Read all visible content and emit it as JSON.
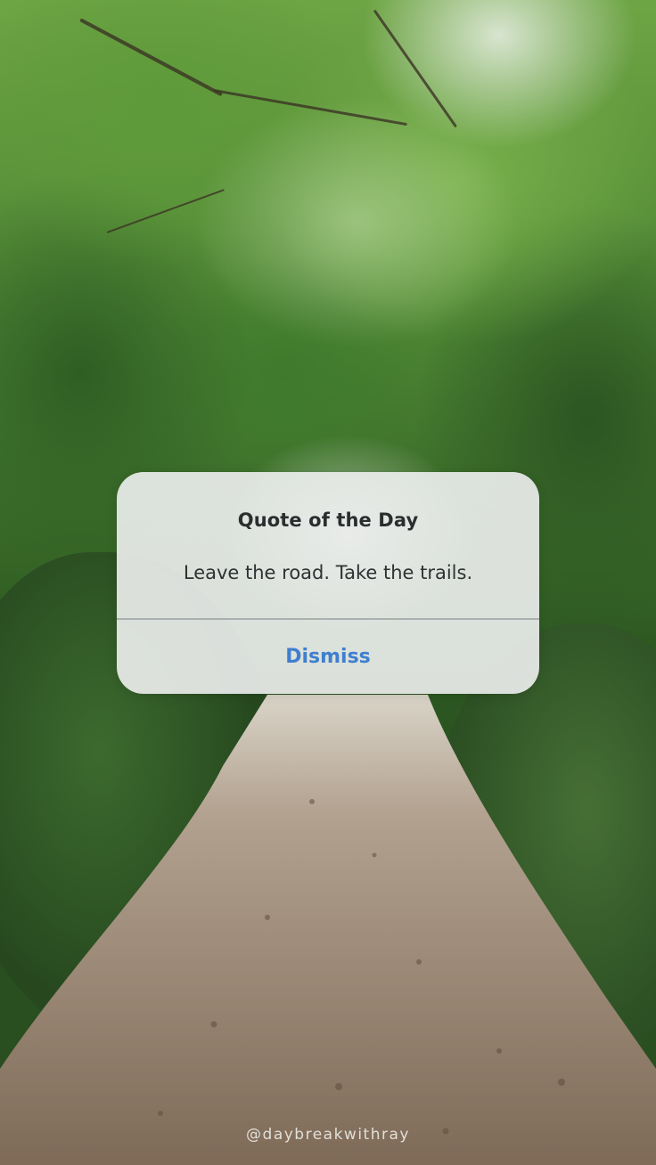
{
  "dialog": {
    "title": "Quote of the Day",
    "message": "Leave the road. Take the trails.",
    "dismiss_label": "Dismiss"
  },
  "watermark": {
    "handle": "@daybreakwithray"
  },
  "colors": {
    "accent": "#3f7fcf",
    "title_text": "#2b2e2f",
    "path": "#8f7a66",
    "foliage": "#4a8232"
  }
}
